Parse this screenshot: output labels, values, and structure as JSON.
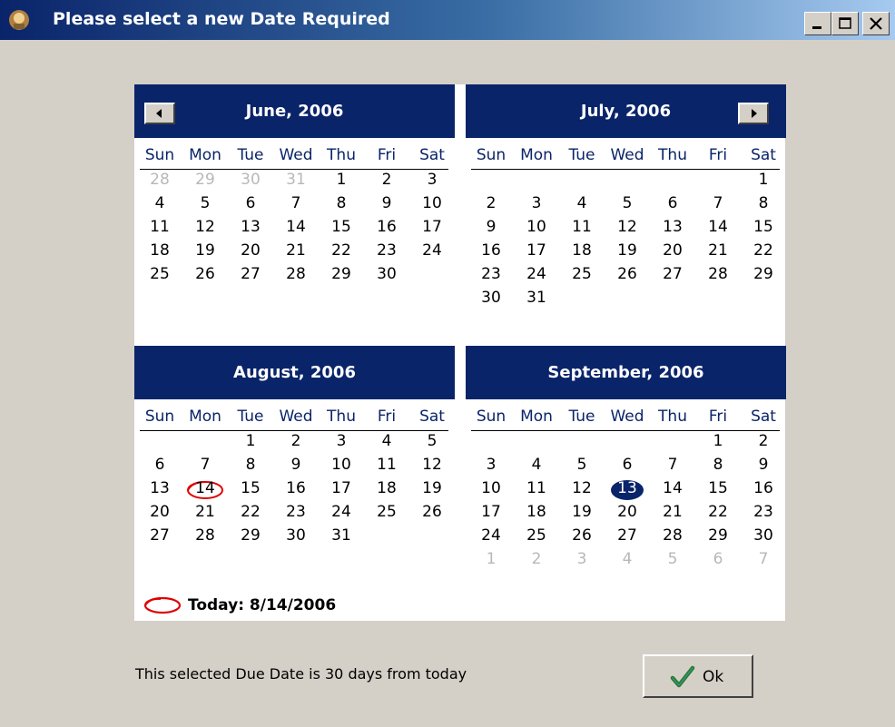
{
  "window": {
    "title": "Please select a new Date Required",
    "controls": [
      "minimize-icon",
      "maximize-icon",
      "close-icon"
    ]
  },
  "weekdays": [
    "Sun",
    "Mon",
    "Tue",
    "Wed",
    "Thu",
    "Fri",
    "Sat"
  ],
  "months": [
    {
      "title": "June, 2006",
      "nav": "prev",
      "days": [
        [
          "28",
          "29",
          "30",
          "31",
          "1",
          "2",
          "3"
        ],
        [
          "4",
          "5",
          "6",
          "7",
          "8",
          "9",
          "10"
        ],
        [
          "11",
          "12",
          "13",
          "14",
          "15",
          "16",
          "17"
        ],
        [
          "18",
          "19",
          "20",
          "21",
          "22",
          "23",
          "24"
        ],
        [
          "25",
          "26",
          "27",
          "28",
          "29",
          "30",
          ""
        ]
      ],
      "grey": [
        [
          0,
          0
        ],
        [
          0,
          1
        ],
        [
          0,
          2
        ],
        [
          0,
          3
        ]
      ]
    },
    {
      "title": "July, 2006",
      "nav": "next",
      "days": [
        [
          "",
          "",
          "",
          "",
          "",
          "",
          "1"
        ],
        [
          "2",
          "3",
          "4",
          "5",
          "6",
          "7",
          "8"
        ],
        [
          "9",
          "10",
          "11",
          "12",
          "13",
          "14",
          "15"
        ],
        [
          "16",
          "17",
          "18",
          "19",
          "20",
          "21",
          "22"
        ],
        [
          "23",
          "24",
          "25",
          "26",
          "27",
          "28",
          "29"
        ],
        [
          "30",
          "31",
          "",
          "",
          "",
          "",
          ""
        ]
      ],
      "grey": []
    },
    {
      "title": "August, 2006",
      "nav": "",
      "days": [
        [
          "",
          "",
          "1",
          "2",
          "3",
          "4",
          "5"
        ],
        [
          "6",
          "7",
          "8",
          "9",
          "10",
          "11",
          "12"
        ],
        [
          "13",
          "14",
          "15",
          "16",
          "17",
          "18",
          "19"
        ],
        [
          "20",
          "21",
          "22",
          "23",
          "24",
          "25",
          "26"
        ],
        [
          "27",
          "28",
          "29",
          "30",
          "31",
          "",
          ""
        ]
      ],
      "grey": [],
      "today": [
        2,
        1
      ]
    },
    {
      "title": "September, 2006",
      "nav": "",
      "days": [
        [
          "",
          "",
          "",
          "",
          "",
          "1",
          "2"
        ],
        [
          "3",
          "4",
          "5",
          "6",
          "7",
          "8",
          "9"
        ],
        [
          "10",
          "11",
          "12",
          "13",
          "14",
          "15",
          "16"
        ],
        [
          "17",
          "18",
          "19",
          "20",
          "21",
          "22",
          "23"
        ],
        [
          "24",
          "25",
          "26",
          "27",
          "28",
          "29",
          "30"
        ],
        [
          "1",
          "2",
          "3",
          "4",
          "5",
          "6",
          "7"
        ]
      ],
      "grey": [
        [
          5,
          0
        ],
        [
          5,
          1
        ],
        [
          5,
          2
        ],
        [
          5,
          3
        ],
        [
          5,
          4
        ],
        [
          5,
          5
        ],
        [
          5,
          6
        ]
      ],
      "selected": [
        2,
        3
      ]
    }
  ],
  "today_label": "Today: 8/14/2006",
  "message": "This selected Due Date is 30 days from today",
  "ok_button": {
    "label": "Ok",
    "icon": "checkmark-icon"
  },
  "colors": {
    "header": "#0a246a",
    "today_ring": "#e00000",
    "selected": "#0a246a",
    "dialog_bg": "#d4d0c8"
  }
}
